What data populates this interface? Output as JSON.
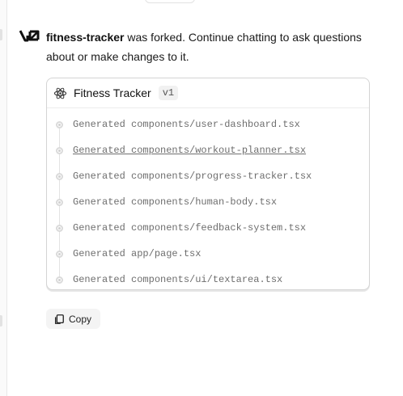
{
  "message": {
    "project_name": "fitness-tracker",
    "text_line1": " was forked. Continue chatting to ask questions",
    "text_line2": "about or make changes to it."
  },
  "card": {
    "title": "Fitness Tracker",
    "version": "v1",
    "icon": "react-icon",
    "files": [
      "Generated components/user-dashboard.tsx",
      "Generated components/workout-planner.tsx",
      "Generated components/progress-tracker.tsx",
      "Generated components/human-body.tsx",
      "Generated components/feedback-system.tsx",
      "Generated app/page.tsx",
      "Generated components/ui/textarea.tsx"
    ]
  },
  "actions": {
    "copy_label": "Copy"
  }
}
